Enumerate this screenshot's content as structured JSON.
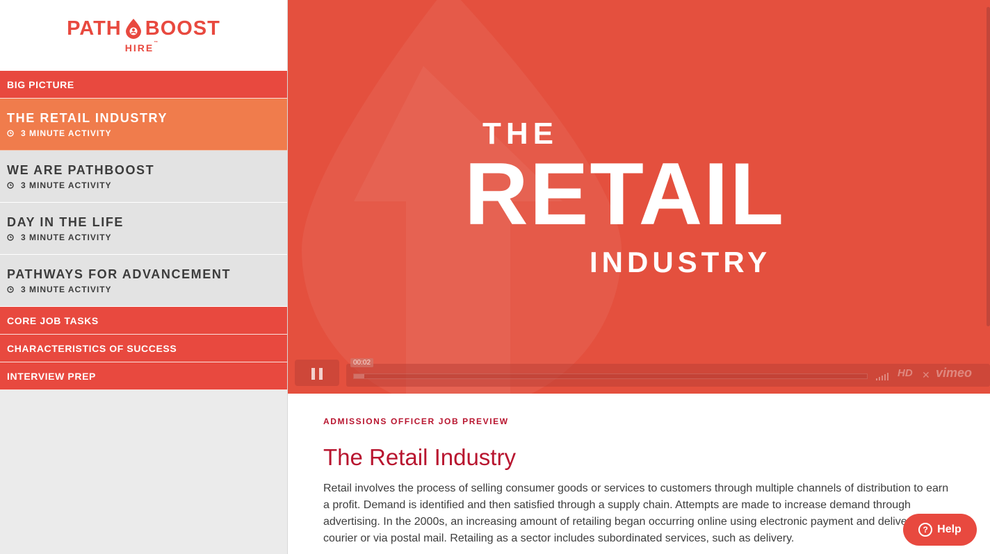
{
  "logo": {
    "brand_left": "PATH",
    "brand_right": "BOOST",
    "sub": "HIRE",
    "tm": "™",
    "color": "#e8493f"
  },
  "sidebar": {
    "items": [
      {
        "label": "BIG PICTURE",
        "style": "red"
      },
      {
        "label": "THE RETAIL INDUSTRY",
        "sub": "3 MINUTE ACTIVITY",
        "style": "active"
      },
      {
        "label": "WE ARE PATHBOOST",
        "sub": "3 MINUTE ACTIVITY",
        "style": "grey"
      },
      {
        "label": "DAY IN THE LIFE",
        "sub": "3 MINUTE ACTIVITY",
        "style": "grey"
      },
      {
        "label": "PATHWAYS FOR ADVANCEMENT",
        "sub": "3 MINUTE ACTIVITY",
        "style": "grey"
      },
      {
        "label": "CORE JOB TASKS",
        "style": "red"
      },
      {
        "label": "CHARACTERISTICS OF SUCCESS",
        "style": "red"
      },
      {
        "label": "INTERVIEW PREP",
        "style": "red"
      }
    ]
  },
  "video": {
    "title_the": "THE",
    "title_retail": "RETAIL",
    "title_industry": "INDUSTRY",
    "time": "00:02",
    "progress": 0.02,
    "hd_label": "HD",
    "brand": "vimeo",
    "bg_color": "#e4503e"
  },
  "content": {
    "preview_label": "ADMISSIONS OFFICER JOB PREVIEW",
    "title": "The Retail Industry",
    "body": "Retail involves the process of selling consumer goods or services to customers through multiple channels of distribution to earn a profit. Demand is identified and then satisfied through a supply chain. Attempts are made to increase demand through advertising. In the 2000s, an increasing amount of retailing began occurring online using electronic payment and delivery via a courier or via postal mail. Retailing as a sector includes subordinated services, such as delivery."
  },
  "help": {
    "label": "Help",
    "icon": "question-circle-icon"
  }
}
